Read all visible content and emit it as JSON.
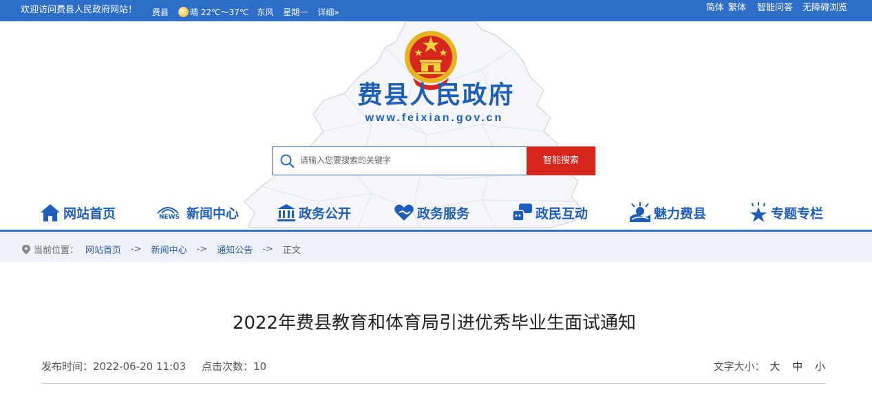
{
  "topbar": {
    "welcome": "欢迎访问费县人民政府网站！",
    "weather_city": "费县",
    "weather_icon": "sun-icon",
    "weather_desc": "晴 22℃～37℃",
    "wind": "东风",
    "weekday": "星期一",
    "detail_link": "详细»",
    "lang_simplified": "简体",
    "lang_traditional": "繁体",
    "smart_qa": "智能问答",
    "accessibility": "无障碍浏览"
  },
  "header": {
    "site_title": "费县人民政府",
    "site_url": "www.feixian.gov.cn",
    "emblem": "national-emblem"
  },
  "search": {
    "placeholder": "请输入您要搜索的关键字",
    "button": "智能搜索"
  },
  "nav": {
    "items": [
      {
        "label": "网站首页",
        "icon": "home-icon"
      },
      {
        "label": "新闻中心",
        "icon": "news-icon",
        "icon_text": "NEWS"
      },
      {
        "label": "政务公开",
        "icon": "building-icon"
      },
      {
        "label": "政务服务",
        "icon": "heart-icon"
      },
      {
        "label": "政民互动",
        "icon": "chat-icon"
      },
      {
        "label": "魅力费县",
        "icon": "landscape-icon"
      },
      {
        "label": "专题专栏",
        "icon": "star-icon"
      }
    ]
  },
  "breadcrumb": {
    "prefix": "当前位置：",
    "items": [
      "网站首页",
      "新闻中心",
      "通知公告",
      "正文"
    ],
    "separator": "->"
  },
  "article": {
    "title": "2022年费县教育和体育局引进优秀毕业生面试通知",
    "publish_label": "发布时间：2022-06-20 11:03",
    "views_label": "点击次数：10",
    "font_size_label": "文字大小：",
    "font_size_options": [
      "大",
      "中",
      "小"
    ]
  },
  "colors": {
    "primary_blue": "#2d6ec8",
    "title_blue": "#1d5eb8",
    "search_red": "#d6251b",
    "crumb_bg": "#edf2f8"
  }
}
